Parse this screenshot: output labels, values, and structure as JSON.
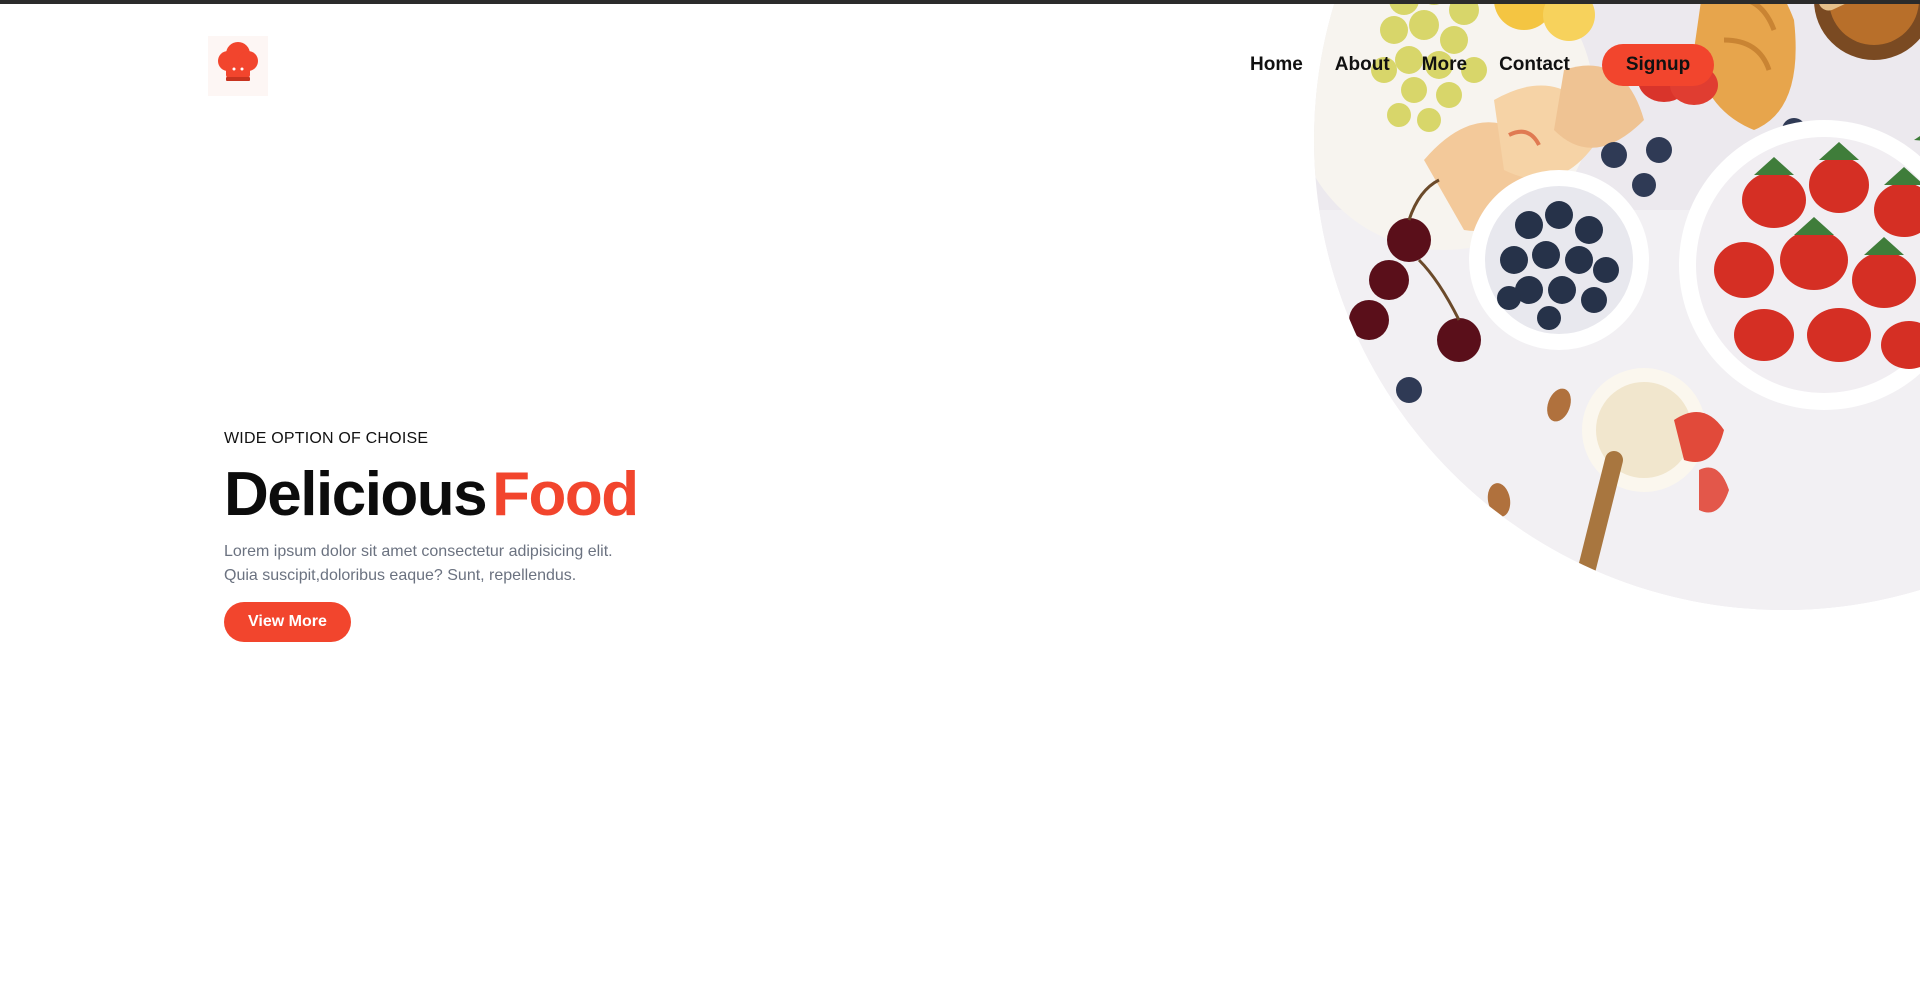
{
  "brand": {
    "logo_icon": "chef-hat-icon",
    "accent_color": "#f2452d"
  },
  "nav": {
    "items": [
      "Home",
      "About",
      "More",
      "Contact"
    ],
    "signup_label": "Signup"
  },
  "hero": {
    "eyebrow": "WIDE OPTION OF CHOISE",
    "title_part1": "Delicious",
    "title_part2": "Food",
    "description": "Lorem ipsum dolor sit amet consectetur adipisicing elit. Quia suscipit,doloribus eaque? Sunt, repellendus.",
    "cta_label": "View More"
  }
}
